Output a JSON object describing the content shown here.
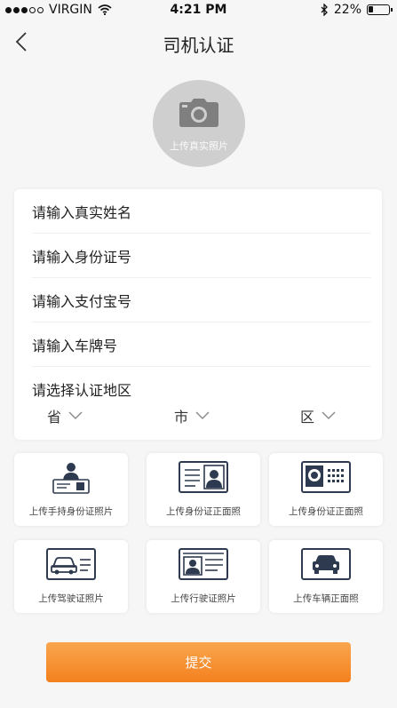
{
  "status_bar": {
    "carrier": "VIRGIN",
    "time": "4:21 PM",
    "battery_percent": "22%",
    "battery_level": 0.22
  },
  "nav": {
    "title": "司机认证"
  },
  "photo": {
    "label": "上传真实照片"
  },
  "form": {
    "name_placeholder": "请输入真实姓名",
    "id_placeholder": "请输入身份证号",
    "alipay_placeholder": "请输入支付宝号",
    "plate_placeholder": "请输入车牌号",
    "region_placeholder": "请选择认证地区",
    "province": "省",
    "city": "市",
    "district": "区"
  },
  "uploads": [
    {
      "label": "上传手持身份证照片",
      "icon": "person-holding-id-icon"
    },
    {
      "label": "上传身份证正面照",
      "icon": "id-card-front-icon"
    },
    {
      "label": "上传身份证正面照",
      "icon": "id-card-emblem-icon"
    },
    {
      "label": "上传驾驶证照片",
      "icon": "driver-license-icon"
    },
    {
      "label": "上传行驶证照片",
      "icon": "vehicle-license-icon"
    },
    {
      "label": "上传车辆正面照",
      "icon": "car-front-icon"
    }
  ],
  "submit_label": "提交",
  "colors": {
    "accent_start": "#f9a64e",
    "accent_end": "#f4801e",
    "background": "#f6f6f6"
  }
}
